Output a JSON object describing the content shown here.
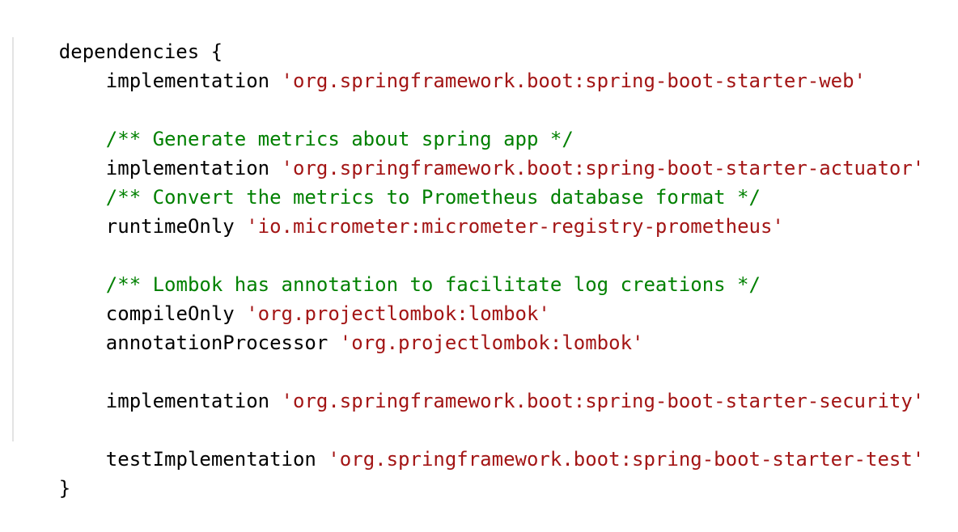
{
  "code": {
    "open_line": "dependencies {",
    "close_line": "}",
    "lines": [
      {
        "kind": "dep",
        "config": "implementation",
        "artifact": "'org.springframework.boot:spring-boot-starter-web'"
      },
      {
        "kind": "comment",
        "text": "/** Generate metrics about spring app */"
      },
      {
        "kind": "dep",
        "config": "implementation",
        "artifact": "'org.springframework.boot:spring-boot-starter-actuator'"
      },
      {
        "kind": "comment",
        "text": "/** Convert the metrics to Prometheus database format */"
      },
      {
        "kind": "dep",
        "config": "runtimeOnly",
        "artifact": "'io.micrometer:micrometer-registry-prometheus'"
      },
      {
        "kind": "comment",
        "text": "/** Lombok has annotation to facilitate log creations */"
      },
      {
        "kind": "dep",
        "config": "compileOnly",
        "artifact": "'org.projectlombok:lombok'"
      },
      {
        "kind": "dep",
        "config": "annotationProcessor",
        "artifact": "'org.projectlombok:lombok'"
      },
      {
        "kind": "dep",
        "config": "implementation",
        "artifact": "'org.springframework.boot:spring-boot-starter-security'"
      },
      {
        "kind": "dep",
        "config": "testImplementation",
        "artifact": "'org.springframework.boot:spring-boot-starter-test'"
      }
    ]
  },
  "colors": {
    "keyword": "#000000",
    "string": "#a31515",
    "comment": "#008000",
    "indent_guide": "#e3e3e3"
  }
}
